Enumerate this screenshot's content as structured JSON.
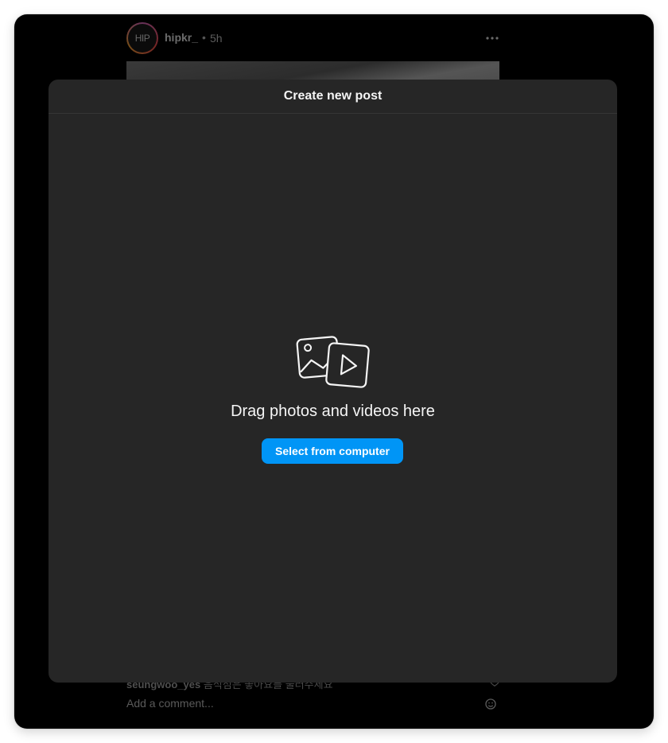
{
  "feed": {
    "avatar_text": "HIP",
    "username": "hipkr_",
    "separator": "•",
    "time": "5h",
    "comment_user": "seungwoo_yes",
    "comment_text": "음식점은 좋아요를 눌러주세요",
    "add_comment_placeholder": "Add a comment..."
  },
  "modal": {
    "title": "Create new post",
    "drag_text": "Drag photos and videos here",
    "select_button_label": "Select from computer"
  },
  "colors": {
    "modal_bg": "#262626",
    "button_blue": "#0095f6",
    "backdrop": "#000000"
  },
  "icons": {
    "more": "more-horizontal-icon",
    "media": "photo-video-icon",
    "heart": "heart-icon",
    "emoji": "emoji-icon"
  }
}
